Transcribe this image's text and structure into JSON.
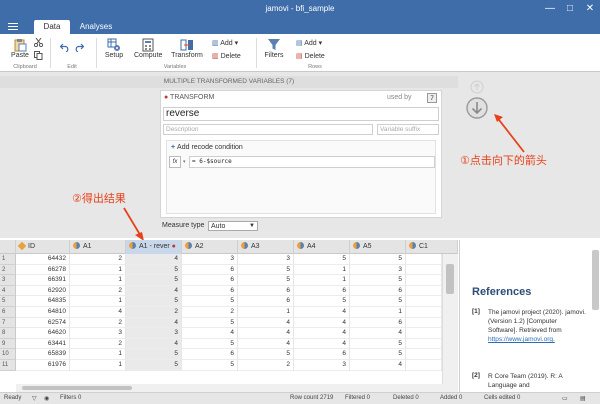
{
  "window": {
    "title": "jamovi - bfi_sample",
    "minimize": "—",
    "maximize": "□",
    "close": "✕"
  },
  "tabs": [
    {
      "label": "Data"
    },
    {
      "label": "Analyses"
    }
  ],
  "ribbon": {
    "paste": "Paste",
    "clipboard_group": "Clipboard",
    "edit_group": "Edit",
    "setup": "Setup",
    "compute": "Compute",
    "transform": "Transform",
    "variables_add": "Add",
    "variables_delete": "Delete",
    "variables_group": "Variables",
    "filters": "Filters",
    "rows_add": "Add",
    "rows_delete": "Delete",
    "rows_group": "Rows"
  },
  "variables_header": "MULTIPLE TRANSFORMED VARIABLES (7)",
  "transform": {
    "heading": "TRANSFORM",
    "used_by_label": "used by",
    "used_by_count": "7",
    "name_value": "reverse",
    "description_placeholder": "Description",
    "suffix_placeholder": "Variable suffix",
    "add_recode": "Add recode condition",
    "fx": "fx",
    "formula": "= 6-$source",
    "measure_type_label": "Measure type",
    "measure_type_value": "Auto"
  },
  "annotations": {
    "click_arrow": "①点击向下的箭头",
    "get_result": "②得出结果"
  },
  "grid": {
    "columns": [
      {
        "name": "ID"
      },
      {
        "name": "A1"
      },
      {
        "name": "A1 - rever"
      },
      {
        "name": "A2"
      },
      {
        "name": "A3"
      },
      {
        "name": "A4"
      },
      {
        "name": "A5"
      },
      {
        "name": "C1"
      }
    ],
    "rows": [
      {
        "n": "1",
        "cells": [
          "64432",
          "2",
          "4",
          "3",
          "3",
          "5",
          "5",
          ""
        ]
      },
      {
        "n": "2",
        "cells": [
          "66278",
          "1",
          "5",
          "6",
          "5",
          "1",
          "3",
          ""
        ]
      },
      {
        "n": "3",
        "cells": [
          "66391",
          "1",
          "5",
          "6",
          "5",
          "1",
          "5",
          ""
        ]
      },
      {
        "n": "4",
        "cells": [
          "62920",
          "2",
          "4",
          "6",
          "6",
          "6",
          "6",
          ""
        ]
      },
      {
        "n": "5",
        "cells": [
          "64835",
          "1",
          "5",
          "5",
          "6",
          "5",
          "5",
          ""
        ]
      },
      {
        "n": "6",
        "cells": [
          "64810",
          "4",
          "2",
          "2",
          "1",
          "4",
          "1",
          ""
        ]
      },
      {
        "n": "7",
        "cells": [
          "62574",
          "2",
          "4",
          "5",
          "4",
          "4",
          "6",
          ""
        ]
      },
      {
        "n": "8",
        "cells": [
          "64620",
          "3",
          "3",
          "4",
          "4",
          "4",
          "4",
          ""
        ]
      },
      {
        "n": "9",
        "cells": [
          "63441",
          "2",
          "4",
          "5",
          "4",
          "4",
          "5",
          ""
        ]
      },
      {
        "n": "10",
        "cells": [
          "65839",
          "1",
          "5",
          "6",
          "5",
          "6",
          "5",
          ""
        ]
      },
      {
        "n": "11",
        "cells": [
          "61976",
          "1",
          "5",
          "5",
          "2",
          "3",
          "4",
          ""
        ]
      }
    ]
  },
  "references": {
    "title": "References",
    "items": [
      {
        "num": "[1]",
        "text": "The jamovi project (2020). jamovi. (Version 1.2) [Computer Software]. Retrieved from",
        "link": "https://www.jamovi.org."
      },
      {
        "num": "[2]",
        "text": "R Core Team (2019). R: A Language and"
      }
    ]
  },
  "status": {
    "ready": "Ready",
    "filters": "Filters 0",
    "row_count": "Row count 2719",
    "filtered": "Filtered 0",
    "deleted": "Deleted 0",
    "added": "Added 0",
    "cells_edited": "Cells edited 0"
  },
  "colors": {
    "accent": "#3e6da9",
    "annotation": "#e8411a",
    "link": "#2a6db5"
  }
}
